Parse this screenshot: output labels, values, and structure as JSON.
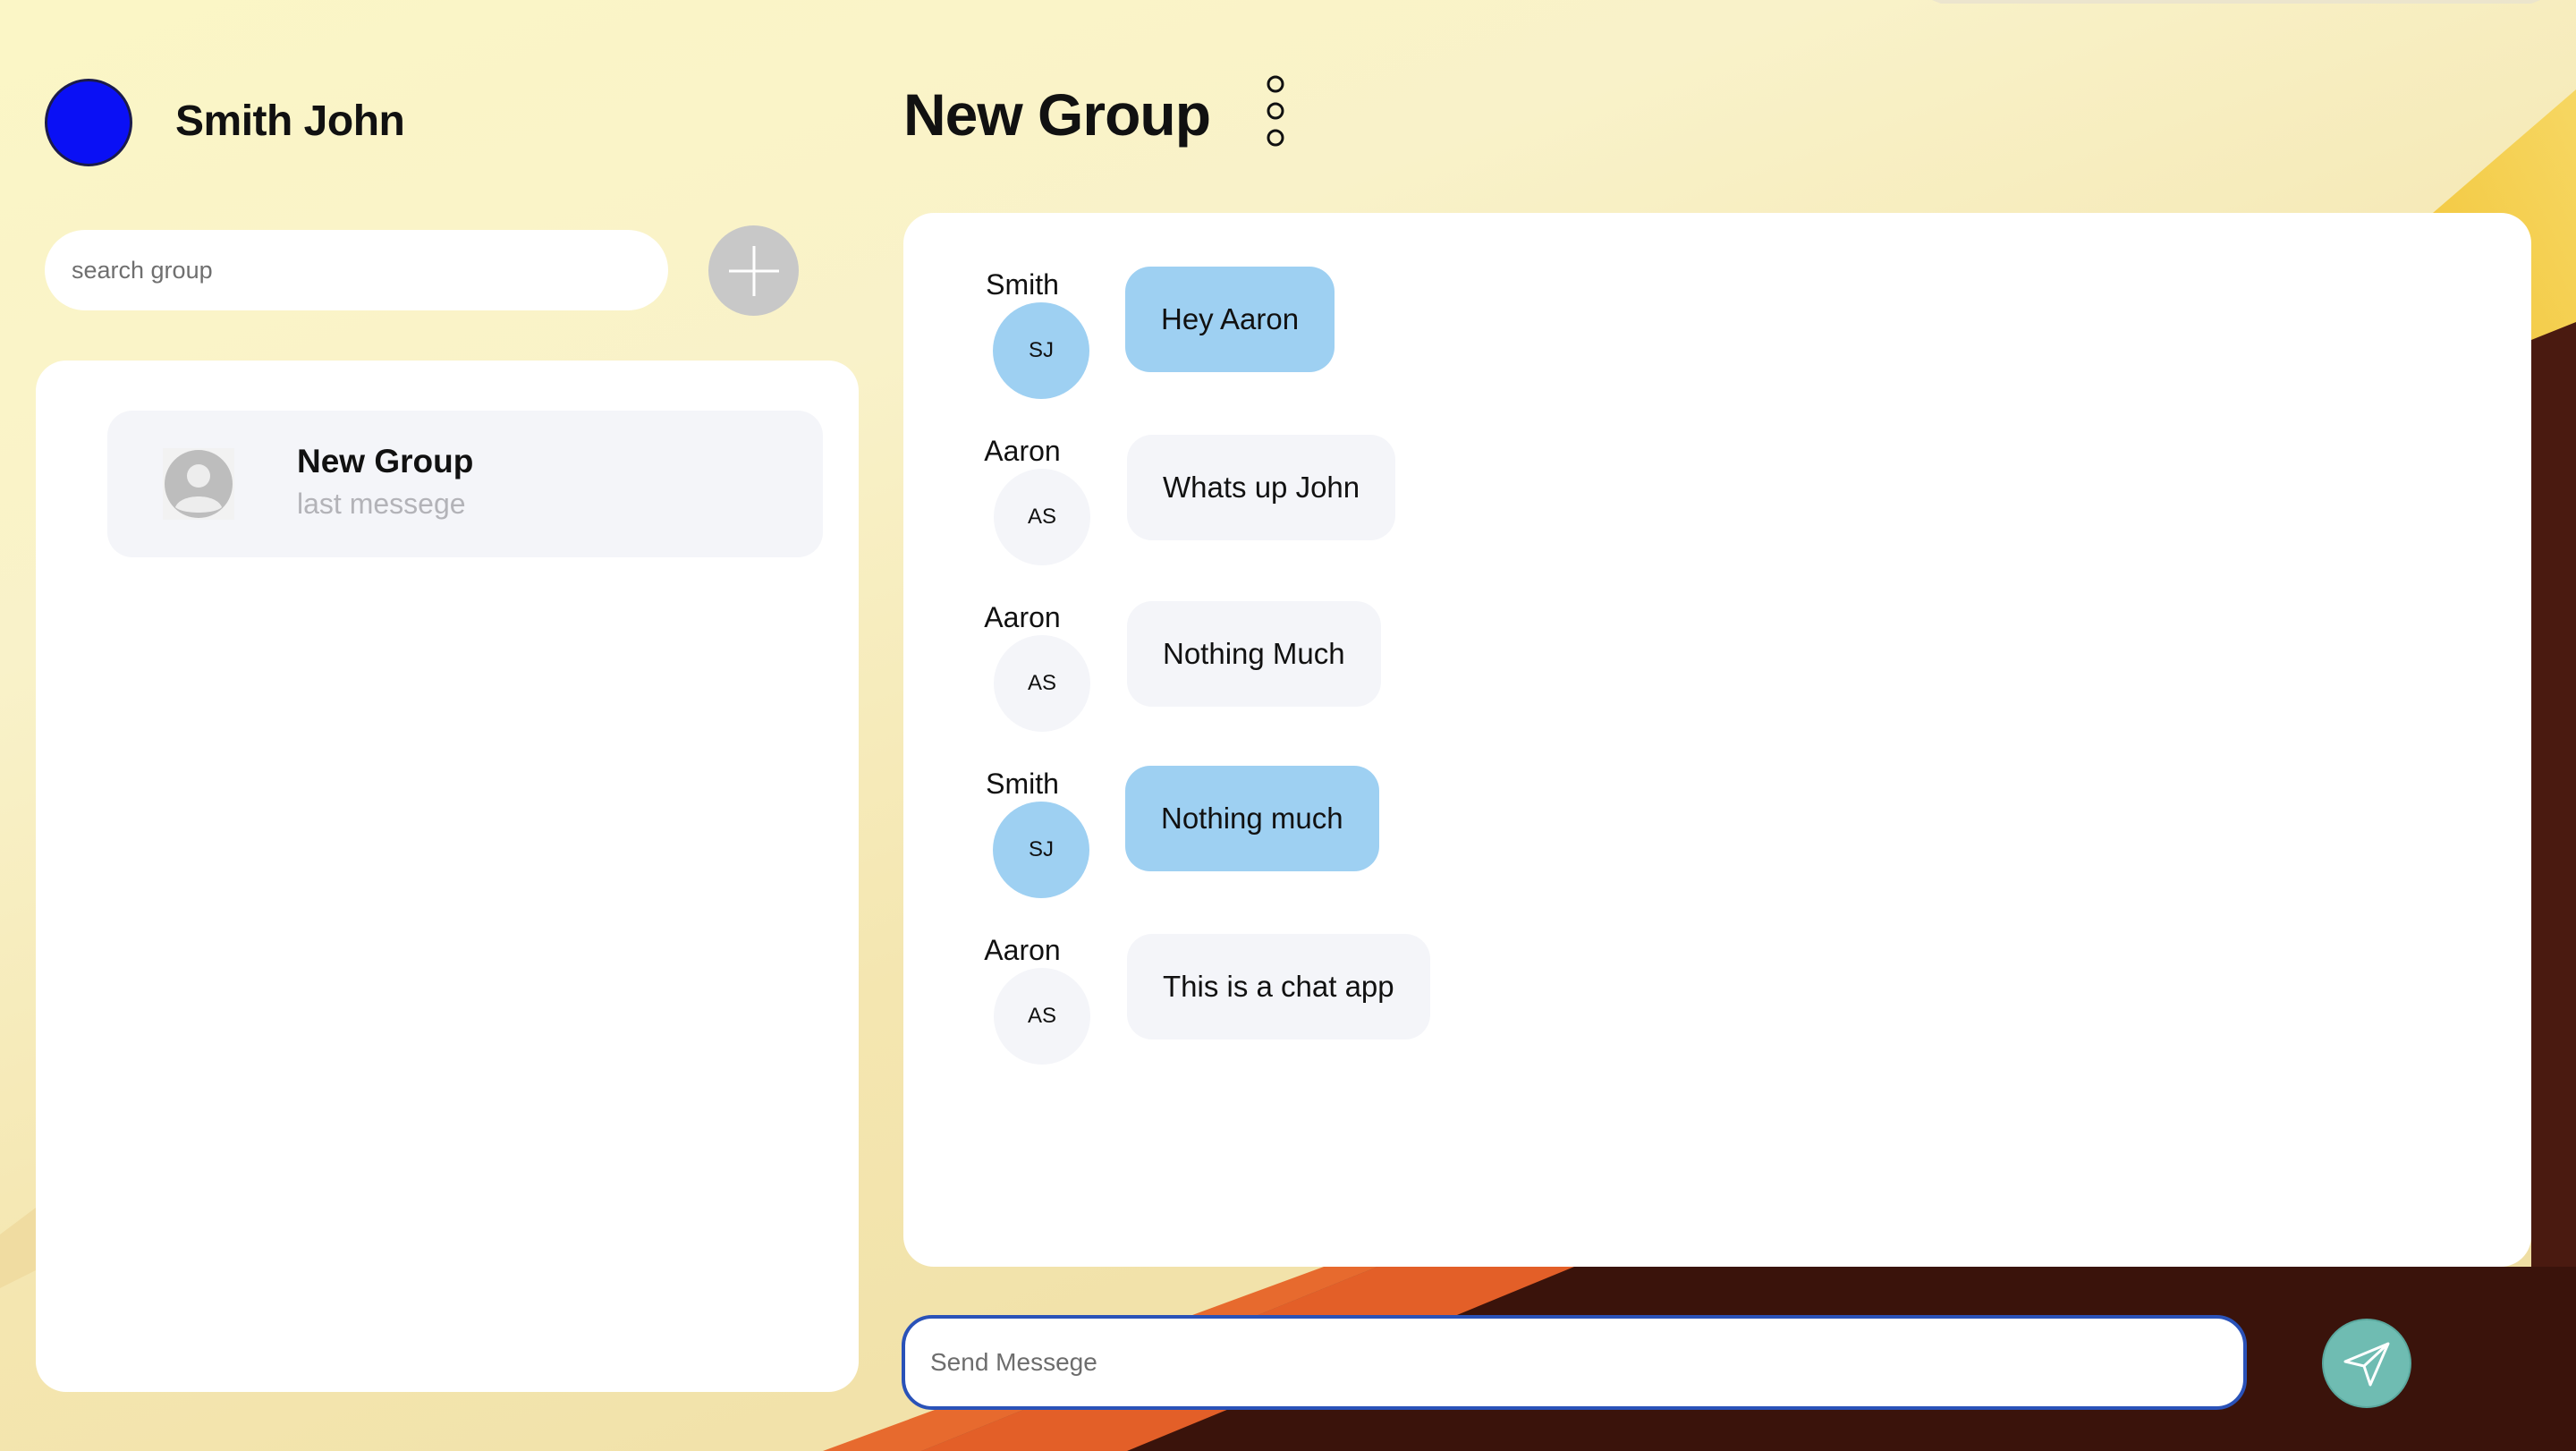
{
  "user": {
    "name": "Smith John",
    "avatar_color": "#0a10f5"
  },
  "search": {
    "placeholder": "search group"
  },
  "groups": [
    {
      "name": "New Group",
      "last_message": "last messege"
    }
  ],
  "chat": {
    "title": "New Group",
    "messages": [
      {
        "sender": "Smith",
        "initials": "SJ",
        "text": "Hey Aaron",
        "mine": true
      },
      {
        "sender": "Aaron",
        "initials": "AS",
        "text": "Whats up John",
        "mine": false
      },
      {
        "sender": "Aaron",
        "initials": "AS",
        "text": "Nothing Much",
        "mine": false
      },
      {
        "sender": "Smith",
        "initials": "SJ",
        "text": "Nothing much",
        "mine": true
      },
      {
        "sender": "Aaron",
        "initials": "AS",
        "text": "This is a chat app",
        "mine": false
      }
    ]
  },
  "composer": {
    "placeholder": "Send Messege"
  },
  "icons": {
    "add": "plus-icon",
    "options": "vertical-dots-icon",
    "send": "paper-plane-icon",
    "group_avatar": "person-placeholder-icon"
  },
  "colors": {
    "my_bubble": "#9ed0f2",
    "their_bubble": "#f4f5f9",
    "send_button": "#6fbcb2",
    "input_focus_border": "#2a52b8"
  }
}
